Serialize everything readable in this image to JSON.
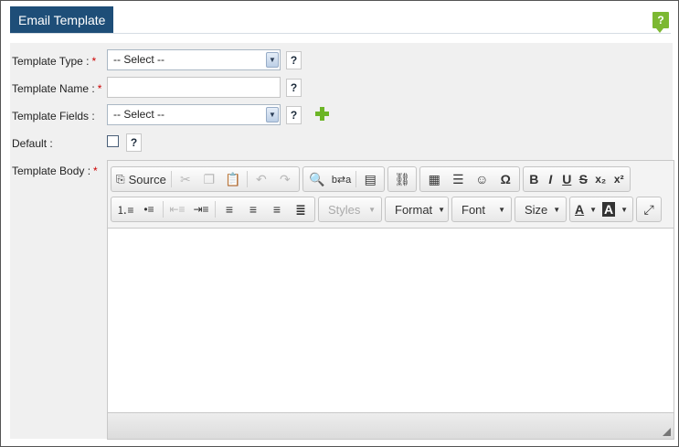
{
  "page": {
    "title": "Email Template",
    "help_symbol": "?"
  },
  "form": {
    "required_mark": "*",
    "template_type": {
      "label": "Template Type :",
      "value": "-- Select --",
      "help": "?"
    },
    "template_name": {
      "label": "Template Name :",
      "value": "",
      "help": "?"
    },
    "template_fields": {
      "label": "Template Fields :",
      "value": "-- Select --",
      "help": "?",
      "add_icon": "plus-icon"
    },
    "default": {
      "label": "Default :",
      "checked": false,
      "help": "?"
    },
    "template_body": {
      "label": "Template Body :"
    }
  },
  "editor": {
    "row1": [
      {
        "icon": "source-icon",
        "label": "Source"
      },
      {
        "icon": "cut-icon"
      },
      {
        "icon": "copy-icon"
      },
      {
        "icon": "paste-icon"
      },
      {
        "icon": "undo-icon"
      },
      {
        "icon": "redo-icon"
      },
      {
        "icon": "find-icon"
      },
      {
        "icon": "replace-icon"
      },
      {
        "icon": "select-all-icon"
      },
      {
        "icon": "link-icon"
      },
      {
        "icon": "table-icon"
      },
      {
        "icon": "horizontal-line-icon"
      },
      {
        "icon": "smiley-icon"
      },
      {
        "icon": "special-char-icon"
      },
      {
        "icon": "bold-icon"
      },
      {
        "icon": "italic-icon"
      },
      {
        "icon": "underline-icon"
      },
      {
        "icon": "strikethrough-icon"
      },
      {
        "icon": "subscript-icon"
      },
      {
        "icon": "superscript-icon"
      }
    ],
    "row2": [
      {
        "icon": "numbered-list-icon"
      },
      {
        "icon": "bulleted-list-icon"
      },
      {
        "icon": "outdent-icon"
      },
      {
        "icon": "indent-icon"
      },
      {
        "icon": "align-left-icon"
      },
      {
        "icon": "align-center-icon"
      },
      {
        "icon": "align-right-icon"
      },
      {
        "icon": "justify-icon"
      }
    ],
    "combos": {
      "styles": "Styles",
      "format": "Format",
      "font": "Font",
      "size": "Size"
    },
    "text_color_icon": "text-color-icon",
    "bg_color_icon": "background-color-icon",
    "maximize_icon": "maximize-icon",
    "glyphs": {
      "bold": "B",
      "italic": "I",
      "underline": "U",
      "strike": "S",
      "omega": "Ω",
      "text_color": "A",
      "bg_color": "A"
    }
  },
  "colors": {
    "title_bg": "#1e4e78",
    "help_green": "#7cb832",
    "required_red": "#cc0000",
    "form_bg": "#f0f0f0"
  }
}
